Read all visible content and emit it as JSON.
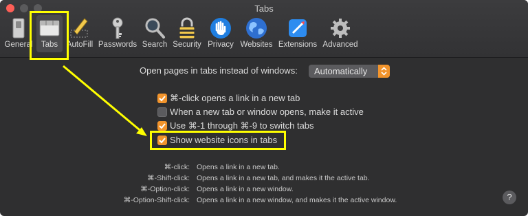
{
  "window": {
    "title": "Tabs"
  },
  "toolbar": {
    "items": [
      {
        "label": "General",
        "icon": "general-switch-icon"
      },
      {
        "label": "Tabs",
        "icon": "tabs-icon",
        "selected": true
      },
      {
        "label": "AutoFill",
        "icon": "pencil-icon"
      },
      {
        "label": "Passwords",
        "icon": "key-icon"
      },
      {
        "label": "Search",
        "icon": "magnifier-icon"
      },
      {
        "label": "Security",
        "icon": "lock-icon"
      },
      {
        "label": "Privacy",
        "icon": "hand-icon"
      },
      {
        "label": "Websites",
        "icon": "globe-icon"
      },
      {
        "label": "Extensions",
        "icon": "extensions-icon"
      },
      {
        "label": "Advanced",
        "icon": "gear-icon"
      }
    ]
  },
  "settings": {
    "open_pages_label": "Open pages in tabs instead of windows:",
    "open_pages_value": "Automatically",
    "checkboxes": [
      {
        "label": "⌘-click opens a link in a new tab",
        "checked": true
      },
      {
        "label": "When a new tab or window opens, make it active",
        "checked": false
      },
      {
        "label": "Use ⌘-1 through ⌘-9 to switch tabs",
        "checked": true
      },
      {
        "label": "Show website icons in tabs",
        "checked": true
      }
    ]
  },
  "help": [
    {
      "key": "⌘-click:",
      "value": "Opens a link in a new tab."
    },
    {
      "key": "⌘-Shift-click:",
      "value": "Opens a link in a new tab, and makes it the active tab."
    },
    {
      "key": "⌘-Option-click:",
      "value": "Opens a link in a new window."
    },
    {
      "key": "⌘-Option-Shift-click:",
      "value": "Opens a link in a new window, and makes it the active window."
    }
  ],
  "help_button": "?",
  "colors": {
    "accent": "#f2942c",
    "highlight": "#ffff00",
    "background": "#2f2f30"
  }
}
